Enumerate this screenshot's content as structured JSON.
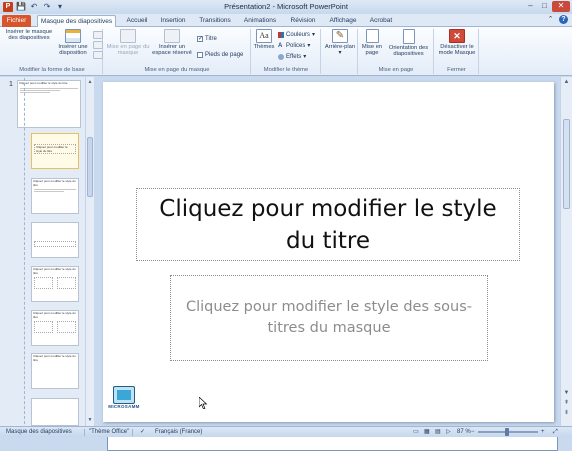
{
  "window": {
    "title": "Présentation2 - Microsoft PowerPoint"
  },
  "quick_access": {
    "app_icon": "P",
    "save_icon": "💾",
    "undo_icon": "↶",
    "redo_icon": "↷",
    "more_icon": "▾"
  },
  "window_buttons": {
    "minimize": "–",
    "maximize": "□",
    "close": "✕"
  },
  "tabs": {
    "file": "Fichier",
    "slide_master": "Masque des diapositives",
    "home": "Accueil",
    "insert": "Insertion",
    "transitions": "Transitions",
    "animations": "Animations",
    "review": "Révision",
    "view": "Affichage",
    "acrobat": "Acrobat"
  },
  "ribbon": {
    "group_edit_master": {
      "label": "Modifier la forme de base",
      "insert_master": "Insérer le masque des diapositives",
      "insert_layout": "Insérer une disposition"
    },
    "group_master_layout": {
      "label": "Mise en page du masque",
      "master_layout": "Mise en page du masque",
      "insert_placeholder": "Insérer un espace réservé",
      "title_checkbox": "Titre",
      "title_checked": true,
      "footers_checkbox": "Pieds de page",
      "footers_checked": false
    },
    "group_edit_theme": {
      "label": "Modifier le thème",
      "themes": "Thèmes",
      "colors": "Couleurs",
      "fonts": "Polices",
      "effects": "Effets"
    },
    "group_background": {
      "background_styles": "Arrière-plan"
    },
    "group_page_setup": {
      "label": "Mise en page",
      "page_setup": "Mise en page",
      "orientation": "Orientation des diapositives"
    },
    "group_close": {
      "label": "Fermer",
      "close_master": "Désactiver le mode Masque"
    }
  },
  "slide_pane": {
    "first_number": "1",
    "thumb_title": "Cliquez pour modifier le style du titre"
  },
  "slide": {
    "title_placeholder": "Cliquez pour modifier le style du titre",
    "subtitle_placeholder": "Cliquez pour modifier le style des sous-titres du masque",
    "watermark": "MICROSAMM"
  },
  "statusbar": {
    "view": "Masque des diapositives",
    "theme": "\"Thème Office\"",
    "language": "Français (France)",
    "zoom": "87 %"
  }
}
